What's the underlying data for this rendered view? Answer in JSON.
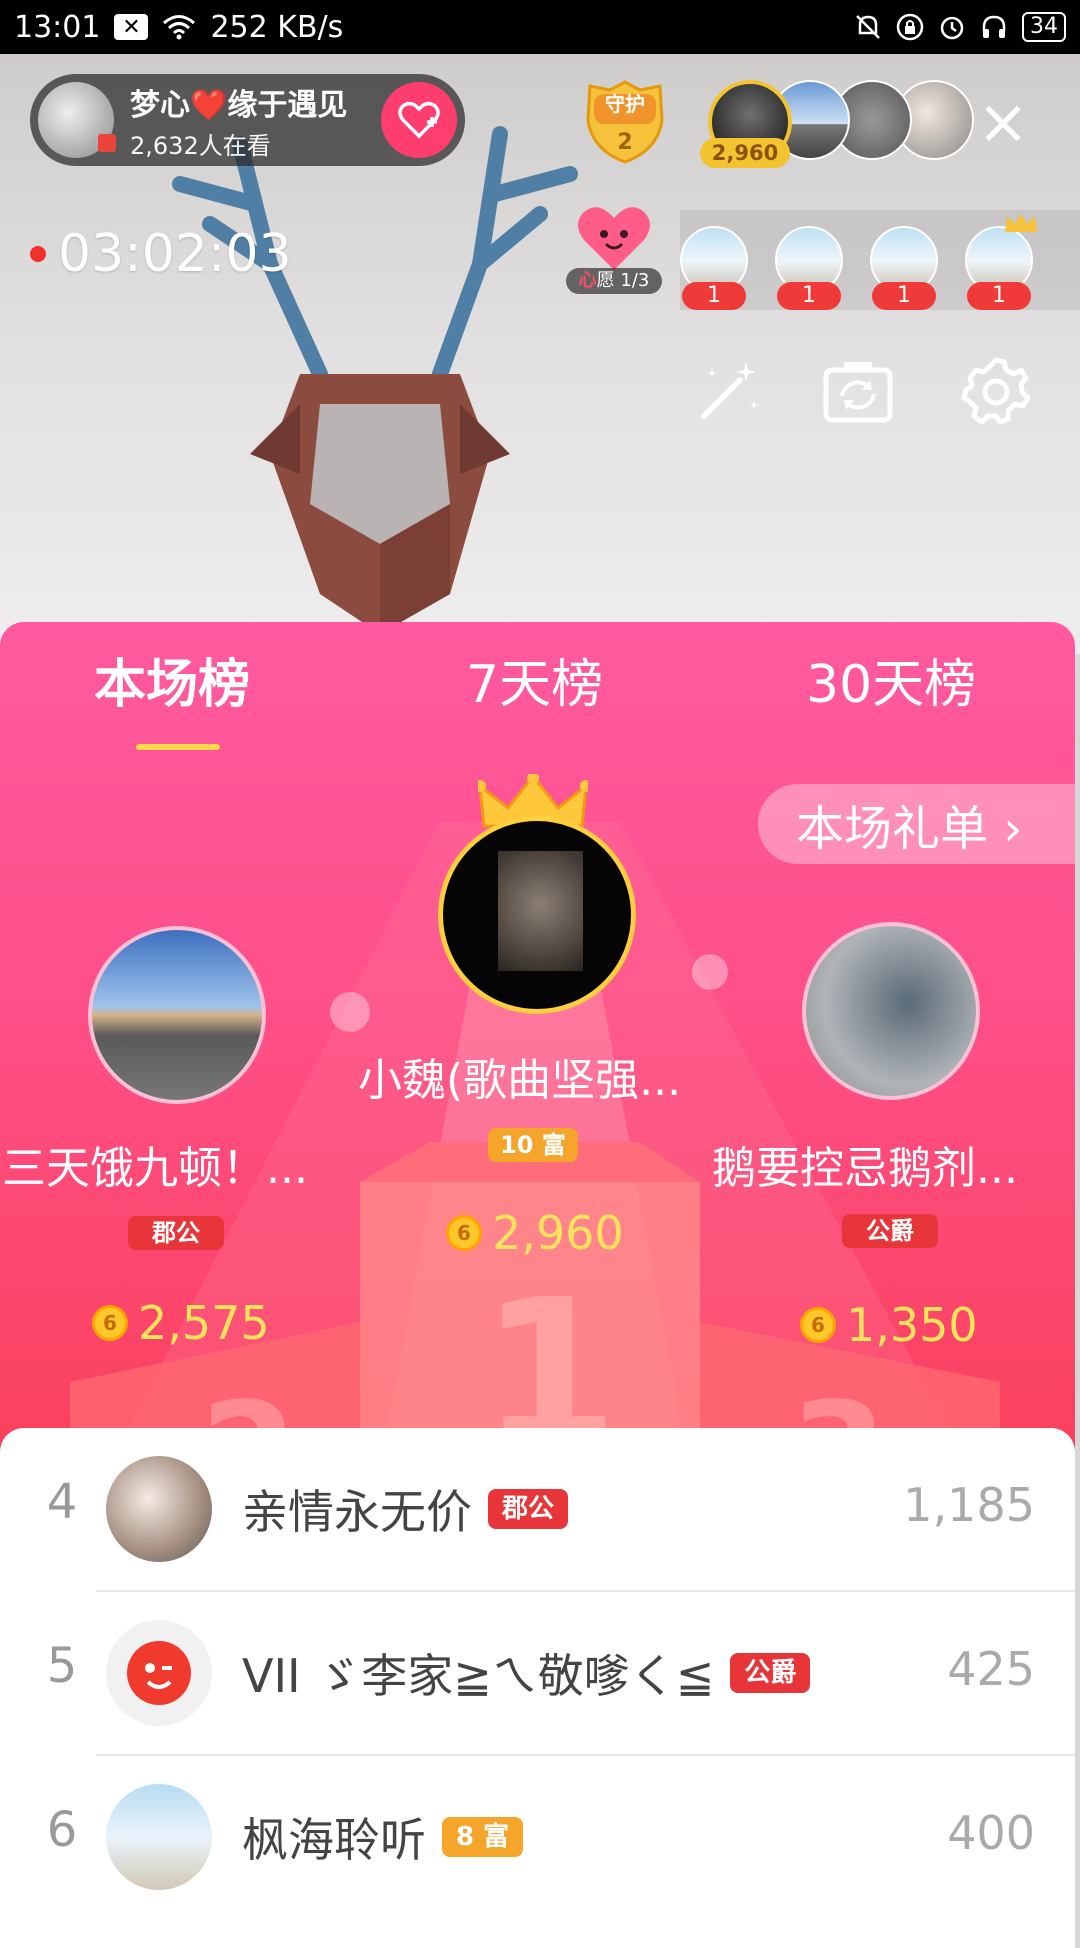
{
  "status_bar": {
    "time": "13:01",
    "network_speed": "252 KB/s",
    "battery": "34"
  },
  "live_room": {
    "host_name": "梦心❤️缘于遇见",
    "viewers": "2,632人在看",
    "guard_label": "守护",
    "guard_count": "2",
    "top_viewer_score": "2,960",
    "timer": "03:02:03",
    "wish_label": "心",
    "wish_progress": "愿 1/3",
    "rank_users": [
      {
        "count": "1"
      },
      {
        "count": "1"
      },
      {
        "count": "1"
      },
      {
        "count": "1"
      }
    ]
  },
  "ranking": {
    "tabs": [
      "本场榜",
      "7天榜",
      "30天榜"
    ],
    "active_tab": 0,
    "gift_list_label": "本场礼单 ›",
    "podium": [
      {
        "rank": 2,
        "name": "三天饿九顿！...",
        "badge": "郡公",
        "score": "2,575"
      },
      {
        "rank": 1,
        "name": "小魏(歌曲坚强...",
        "badge": "10 富",
        "score": "2,960"
      },
      {
        "rank": 3,
        "name": "鹅要控忌鹅剂...",
        "badge": "公爵",
        "score": "1,350"
      }
    ],
    "list": [
      {
        "rank": "4",
        "name": "亲情永无价",
        "badge": "郡公",
        "score": "1,185"
      },
      {
        "rank": "5",
        "name": "VII ゞ李家≧ㄟ敬嗲く≦",
        "badge": "公爵",
        "score": "425"
      },
      {
        "rank": "6",
        "name": "枫海聆听",
        "badge": "8 富",
        "score": "400"
      }
    ]
  },
  "colors": {
    "panel_top": "#ff5aa0",
    "panel_bottom": "#f63a4a",
    "gold": "#ffe35a",
    "badge_red": "#e8353a",
    "badge_orange": "#f4a52a"
  },
  "icons": [
    "wifi-icon",
    "silent-icon",
    "lock-icon",
    "alarm-icon",
    "headphones-icon",
    "magic-wand-icon",
    "camera-flip-icon",
    "settings-gear-icon",
    "close-icon",
    "crown-icon",
    "coin-icon",
    "heart-plus-icon"
  ]
}
